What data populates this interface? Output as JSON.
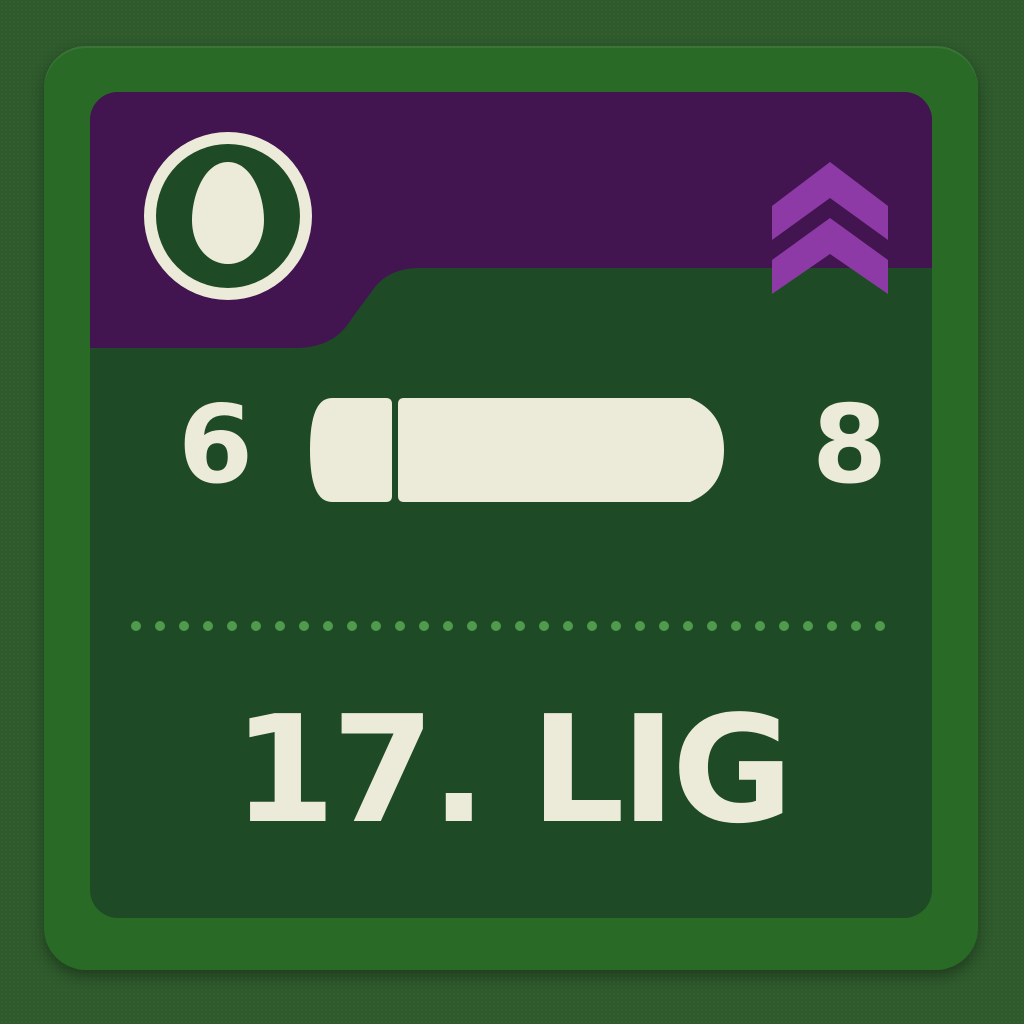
{
  "counter": {
    "attack": "6",
    "movement": "8",
    "designation": "17. LIG",
    "unit_symbol": "circle-egg-icon",
    "rank_icon": "double-chevron-icon",
    "ammo_icon": "bullet-icon"
  },
  "colors": {
    "table_bg": "#2e5a2c",
    "counter_border": "#2a6a27",
    "counter_body": "#1e4a26",
    "header_purple": "#421450",
    "chevron_purple": "#8e3aa6",
    "ink": "#ecebd9",
    "dots": "#4f9a4d"
  }
}
